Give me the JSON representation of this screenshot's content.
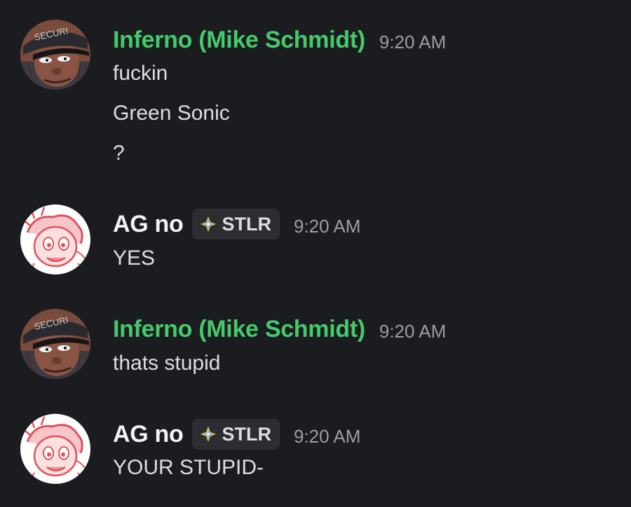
{
  "messages": [
    {
      "author": "Inferno (Mike Schmidt)",
      "time": "9:20 AM",
      "avatar_hat_text": "SECURITY",
      "lines": [
        "fuckin",
        "Green Sonic",
        "?"
      ]
    },
    {
      "author": "AG no",
      "tag": "STLR",
      "time": "9:20 AM",
      "lines": [
        "YES"
      ]
    },
    {
      "author": "Inferno (Mike Schmidt)",
      "time": "9:20 AM",
      "avatar_hat_text": "SECURITY",
      "lines": [
        "thats stupid"
      ]
    },
    {
      "author": "AG no",
      "tag": "STLR",
      "time": "9:20 AM",
      "lines": [
        "YOUR STUPID-"
      ]
    }
  ],
  "colors": {
    "background": "#1b1c20",
    "username_green": "#44c96b",
    "username_white": "#f2f3f5",
    "timestamp": "#9c9ea6",
    "tag_bg": "#2c2d32",
    "message_text": "#dddee2"
  },
  "icons": {
    "tag_icon": "diamond-sparkle-icon"
  }
}
